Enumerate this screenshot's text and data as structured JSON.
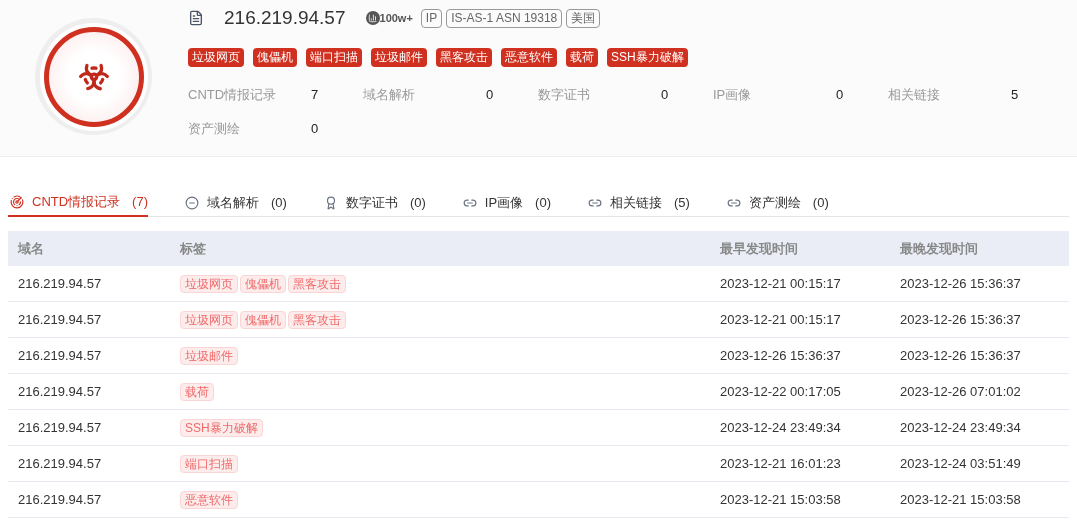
{
  "header": {
    "ip": "216.219.94.57",
    "count": "100w+",
    "badges": [
      "IP",
      "IS-AS-1 ASN 19318",
      "美国"
    ],
    "tags": [
      "垃圾网页",
      "傀儡机",
      "端口扫描",
      "垃圾邮件",
      "黑客攻击",
      "恶意软件",
      "载荷",
      "SSH暴力破解"
    ],
    "stats": [
      {
        "label": "CNTD情报记录",
        "value": "7"
      },
      {
        "label": "域名解析",
        "value": "0"
      },
      {
        "label": "数字证书",
        "value": "0"
      },
      {
        "label": "IP画像",
        "value": "0"
      },
      {
        "label": "相关链接",
        "value": "5"
      },
      {
        "label": "资产测绘",
        "value": "0"
      }
    ]
  },
  "tabs": [
    {
      "label": "CNTD情报记录",
      "count": "(7)",
      "selected": true,
      "kind": "radar"
    },
    {
      "label": "域名解析",
      "count": "(0)",
      "selected": false,
      "kind": "minus"
    },
    {
      "label": "数字证书",
      "count": "(0)",
      "selected": false,
      "kind": "award"
    },
    {
      "label": "IP画像",
      "count": "(0)",
      "selected": false,
      "kind": "link"
    },
    {
      "label": "相关链接",
      "count": "(5)",
      "selected": false,
      "kind": "link"
    },
    {
      "label": "资产测绘",
      "count": "(0)",
      "selected": false,
      "kind": "link"
    }
  ],
  "table": {
    "columns": [
      "域名",
      "标签",
      "最早发现时间",
      "最晚发现时间"
    ],
    "rows": [
      {
        "domain": "216.219.94.57",
        "tags": [
          "垃圾网页",
          "傀儡机",
          "黑客攻击"
        ],
        "first": "2023-12-21 00:15:17",
        "last": "2023-12-26 15:36:37"
      },
      {
        "domain": "216.219.94.57",
        "tags": [
          "垃圾网页",
          "傀儡机",
          "黑客攻击"
        ],
        "first": "2023-12-21 00:15:17",
        "last": "2023-12-26 15:36:37"
      },
      {
        "domain": "216.219.94.57",
        "tags": [
          "垃圾邮件"
        ],
        "first": "2023-12-26 15:36:37",
        "last": "2023-12-26 15:36:37"
      },
      {
        "domain": "216.219.94.57",
        "tags": [
          "载荷"
        ],
        "first": "2023-12-22 00:17:05",
        "last": "2023-12-26 07:01:02"
      },
      {
        "domain": "216.219.94.57",
        "tags": [
          "SSH暴力破解"
        ],
        "first": "2023-12-24 23:49:34",
        "last": "2023-12-24 23:49:34"
      },
      {
        "domain": "216.219.94.57",
        "tags": [
          "端口扫描"
        ],
        "first": "2023-12-21 16:01:23",
        "last": "2023-12-24 03:51:49"
      },
      {
        "domain": "216.219.94.57",
        "tags": [
          "恶意软件"
        ],
        "first": "2023-12-21 15:03:58",
        "last": "2023-12-21 15:03:58"
      }
    ]
  }
}
